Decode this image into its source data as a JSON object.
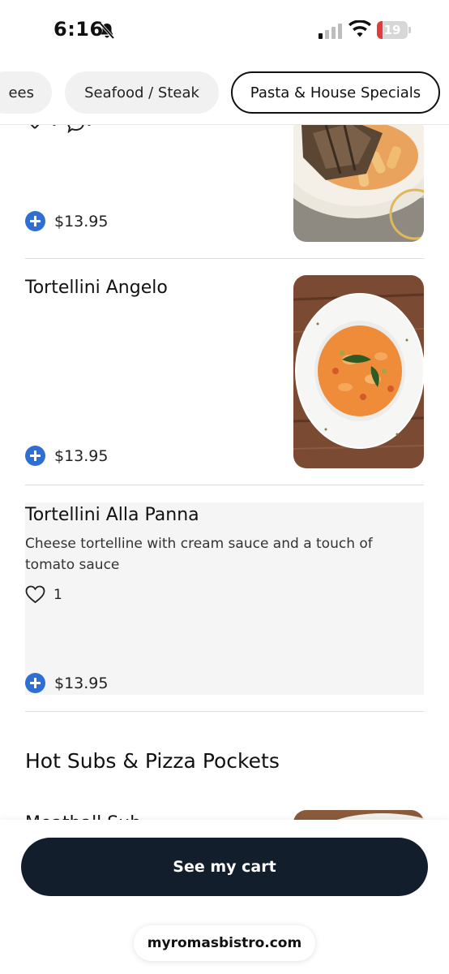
{
  "status_bar": {
    "time": "6:16",
    "battery_level": "19",
    "battery_fraction": 0.19,
    "icons": [
      "bell-slash-icon",
      "signal-icon",
      "wifi-icon",
      "battery-icon"
    ]
  },
  "tabs": [
    {
      "label": "ees",
      "selected": false
    },
    {
      "label": "Seafood / Steak",
      "selected": false
    },
    {
      "label": "Pasta & House Specials",
      "selected": true
    }
  ],
  "menu": {
    "items": [
      {
        "name": "",
        "price": "$13.95",
        "image": "grilled-chicken-pasta-photo"
      },
      {
        "name": "Tortellini Angelo",
        "price": "$13.95",
        "image": "tortellini-angelo-photo"
      },
      {
        "name": "Tortellini Alla Panna",
        "description": "Cheese tortelline with cream sauce and a touch of tomato sauce",
        "likes": "1",
        "price": "$13.95"
      }
    ],
    "section_title": "Hot Subs & Pizza Pockets",
    "partial_item_name": "Meatball Sub"
  },
  "cart_button": {
    "label": "See my cart"
  },
  "url_bar": {
    "domain": "myromasbistro.com"
  },
  "colors": {
    "accent_blue": "#2f6fd3",
    "cart_button_bg": "#131e2c",
    "battery_red": "#e33b3b"
  }
}
